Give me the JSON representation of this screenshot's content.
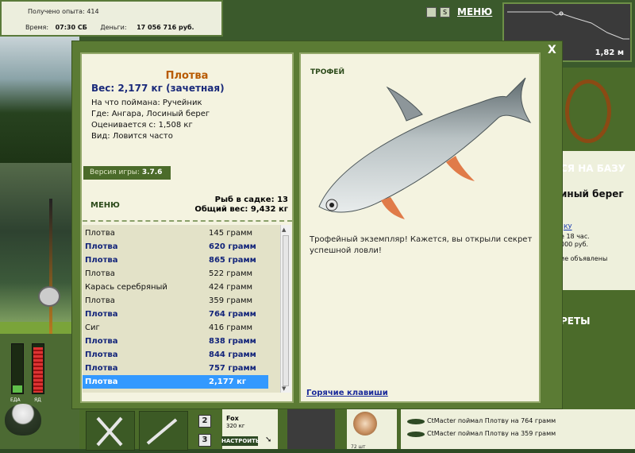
{
  "header": {
    "experience_label": "Получено опыта:",
    "experience_value": "414",
    "time_label": "Время:",
    "time_value": "07:30 СБ",
    "money_label": "Деньги:",
    "money_value": "17 056 716 руб.",
    "menu_label": "МЕНЮ",
    "sound_icon_text": "S"
  },
  "depth": {
    "value": "1,82 м"
  },
  "right_panel": {
    "go_to_base": "СЯ НА БАЗУ",
    "shore": "иный берег",
    "link": "КУ",
    "time": "е 18 час.",
    "price": "000 руб.",
    "ads": "ие объявлены",
    "secrets": "РЕТЫ"
  },
  "news": [
    "CtMacter поймал Плотву на 764 грамм",
    "CtMacter поймал Плотву на 359 грамм"
  ],
  "toolbar": {
    "slot_numbers": [
      "2",
      "3"
    ],
    "fox_name": "Fox",
    "fox_weight": "320 кг",
    "adjust_label": "НАСТРОИТЬ",
    "bait_count": "72 шт"
  },
  "gauges": {
    "food_label": "ЕДА",
    "hunger_label": "ЯД",
    "food_level": 0.15,
    "hunger_level": 0.95
  },
  "dialog": {
    "close_label": "X",
    "fish_title": "Плотва",
    "fish_weight": "Вес: 2,177 кг (зачетная)",
    "details": [
      "На что поймана: Ручейник",
      "Где: Ангара, Лосиный берег",
      "Оценивается с: 1,508 кг",
      "Вид: Ловится часто"
    ],
    "version_label": "Версия игры:",
    "version_value": "3.7.6",
    "menu_label": "МЕНЮ",
    "keep_count": "Рыб в садке: 13",
    "keep_weight": "Общий вес: 9,432 кг",
    "catch_list": [
      {
        "name": "Плотва",
        "weight": "145 грамм",
        "highlight": false
      },
      {
        "name": "Плотва",
        "weight": "620 грамм",
        "highlight": true
      },
      {
        "name": "Плотва",
        "weight": "865 грамм",
        "highlight": true
      },
      {
        "name": "Плотва",
        "weight": "522 грамм",
        "highlight": false
      },
      {
        "name": "Карась серебряный",
        "weight": "424 грамм",
        "highlight": false
      },
      {
        "name": "Плотва",
        "weight": "359 грамм",
        "highlight": false
      },
      {
        "name": "Плотва",
        "weight": "764 грамм",
        "highlight": true
      },
      {
        "name": "Сиг",
        "weight": "416 грамм",
        "highlight": false
      },
      {
        "name": "Плотва",
        "weight": "838 грамм",
        "highlight": true
      },
      {
        "name": "Плотва",
        "weight": "844 грамм",
        "highlight": true
      },
      {
        "name": "Плотва",
        "weight": "757 грамм",
        "highlight": true
      },
      {
        "name": "Плотва",
        "weight": "2,177 кг",
        "highlight": true,
        "selected": true
      }
    ],
    "trophy_title": "ТРОФЕЙ",
    "trophy_text": "Трофейный экземпляр! Кажется, вы открыли секрет успешной ловли!",
    "hotkeys_label": "Горячие клавиши"
  }
}
